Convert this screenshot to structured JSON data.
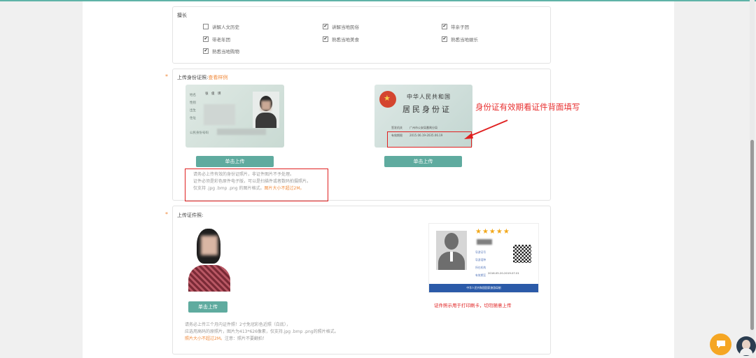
{
  "specialty": {
    "title": "擅长",
    "options": [
      {
        "label": "讲解人文历史",
        "checked": false
      },
      {
        "label": "讲解当地民俗",
        "checked": true
      },
      {
        "label": "带亲子团",
        "checked": true
      },
      {
        "label": "带老年团",
        "checked": true
      },
      {
        "label": "熟悉当地美食",
        "checked": true
      },
      {
        "label": "熟悉当地娱乐",
        "checked": true
      },
      {
        "label": "熟悉当地购物",
        "checked": true
      }
    ]
  },
  "id_upload": {
    "required_mark": "*",
    "title": "上传身份证照:",
    "example_link": "查看样例",
    "front_upload_button": "单击上传",
    "back_upload_button": "单击上传",
    "front_card": {
      "name_label": "姓名",
      "name_value": "张　俊　瑛",
      "sex_label": "性别",
      "birth_label": "出生",
      "address_label": "住址",
      "id_label": "公民身份号码"
    },
    "back_card": {
      "line1": "中华人民共和国",
      "line2": "居民身份证",
      "issuer_label": "签发机关",
      "issuer_value": "广州市公安局番禺分局",
      "validity_label": "有效期限",
      "validity_value": "2015.06.19-2035.06.19"
    },
    "annotation": "身份证有效期看证件背面填写",
    "notes": [
      "请务必上传有效的身份证照片，非证件图片不予处理。",
      "证件必须是彩色原件电子版，可以是扫描件或者数码拍摄照片。"
    ],
    "note_formats": "仅支持 .jpg .bmp .png 的图片格式。",
    "note_size": "图片大小不超过2M。"
  },
  "photo_upload": {
    "required_mark": "*",
    "title": "上传证件照:",
    "upload_button": "单击上传",
    "notes": [
      "请务必上传三个月内证件照！2寸免冠彩色近照（白底），",
      "应选用高码的原照片，图片为413*626像素，仅支持.jpg .bmp .png的照片格式。"
    ],
    "note_size": "照片大小不超过2M。",
    "note_tail": "注意：照片不要翻拍！",
    "sample_card": {
      "stars": "★★★★★",
      "number_label": "导游证号",
      "org_label": "导游语种",
      "agency_label": "所在机构",
      "valid_label": "有效期至",
      "valid_value": "2016.05.20-2019.07.01",
      "footer": "中华人民共和国国家旅游局制"
    },
    "sample_caption": "证件照示用于打印刷卡，切勿随意上传"
  },
  "colors": {
    "accent": "#5fab9f",
    "warning": "#f08a3c",
    "annotation": "#e02020"
  }
}
